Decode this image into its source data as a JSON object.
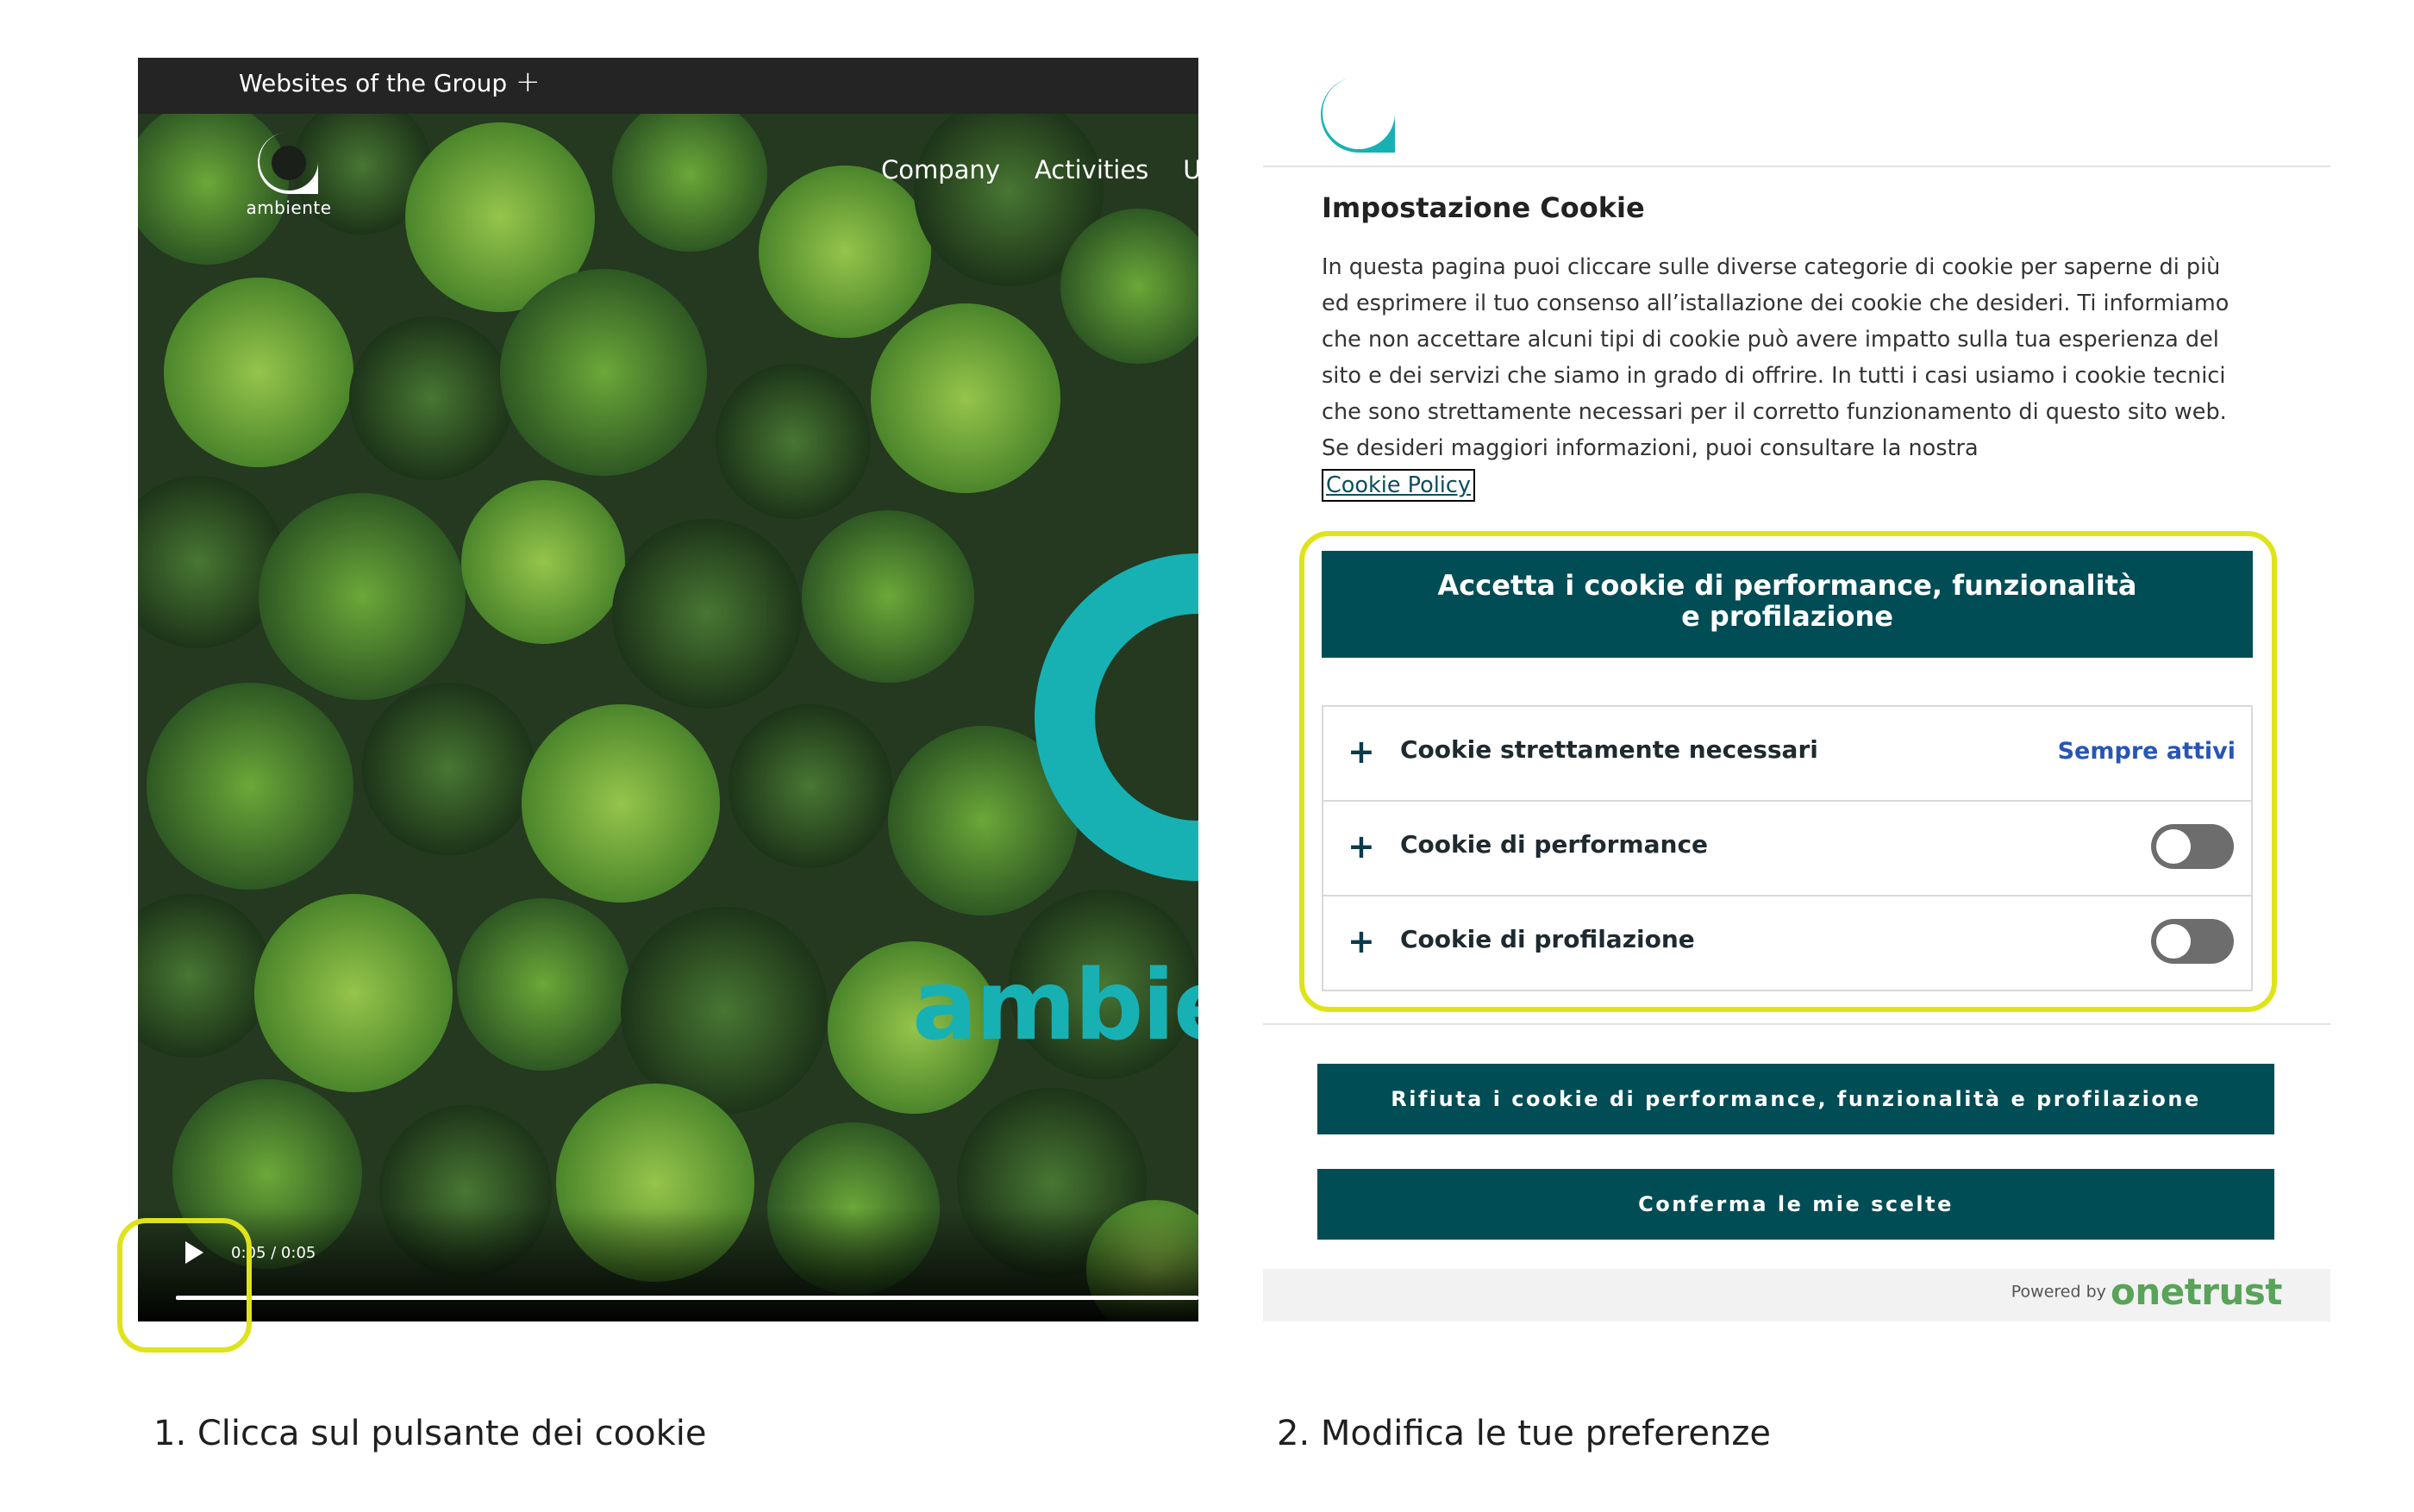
{
  "colors": {
    "brand_teal": "#17b1b4",
    "button_dark_teal": "#004d55",
    "highlight_yellow": "#dfe31a",
    "link_blue": "#2855b5",
    "onetrust_green": "#5aa35a"
  },
  "left_panel": {
    "group_bar": {
      "label": "Websites of the Group",
      "expand_icon": "+"
    },
    "site_logo": {
      "icon": "aceo-logo-icon",
      "text": "ambiente"
    },
    "nav": {
      "items": [
        "Company",
        "Activities",
        "U"
      ]
    },
    "hero": {
      "brand_word": "ambien"
    },
    "video": {
      "play_icon": "play-icon",
      "time": "0:05 / 0:05",
      "progress": 1.0
    },
    "caption": "1. Clicca sul pulsante dei cookie"
  },
  "right_panel": {
    "logo": {
      "icon": "aceo-logo-icon"
    },
    "title": "Impostazione Cookie",
    "description": "In questa pagina puoi cliccare sulle diverse categorie di cookie per saperne di più ed esprimere il tuo consenso all’istallazione dei cookie che desideri. Ti informiamo che non accettare alcuni tipi di cookie può avere impatto sulla tua esperienza del sito e dei servizi che siamo in grado di offrire. In tutti i casi usiamo i cookie tecnici che sono strettamente necessari per il corretto funzionamento di questo sito web. Se desideri maggiori informazioni, puoi consultare la nostra",
    "policy_link": "Cookie Policy",
    "accept_button": "Accetta i cookie di performance, funzionalità e profilazione",
    "categories": [
      {
        "label": "Cookie strettamente necessari",
        "expand": "+",
        "status": "Sempre attivi"
      },
      {
        "label": "Cookie di performance",
        "expand": "+",
        "enabled": false
      },
      {
        "label": "Cookie di profilazione",
        "expand": "+",
        "enabled": false
      }
    ],
    "reject_button": "Rifiuta i cookie di performance, funzionalità e profilazione",
    "confirm_button": "Conferma le mie scelte",
    "footer": {
      "powered_prefix": "Powered by",
      "powered_brand": "onetrust"
    },
    "caption": "2. Modifica le tue preferenze"
  }
}
